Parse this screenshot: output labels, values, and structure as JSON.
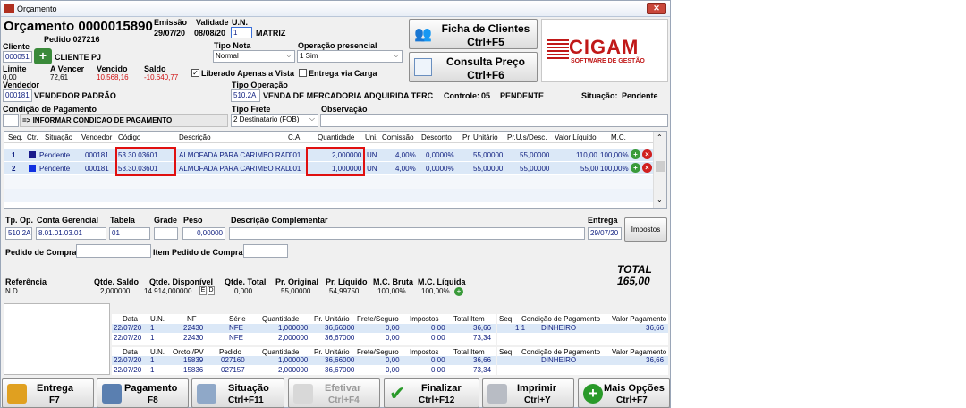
{
  "window": {
    "title": "Orçamento",
    "close": "✕"
  },
  "header": {
    "orcamento_label": "Orçamento 0000015890",
    "pedido": "Pedido 027216",
    "emissao_label": "Emissão",
    "emissao": "29/07/20",
    "validade_label": "Validade",
    "validade": "08/08/20",
    "un_label": "U.N.",
    "un_value": "1",
    "un_name": "MATRIZ"
  },
  "cliente": {
    "label": "Cliente",
    "code": "000051",
    "name": "CLIENTE PJ",
    "limite_label": "Limite",
    "limite": "0,00",
    "avencer_label": "A Vencer",
    "avencer": "72,61",
    "vencido_label": "Vencido",
    "vencido": "10.568,16",
    "saldo_label": "Saldo",
    "saldo": "-10.640,77"
  },
  "tipo_nota": {
    "label": "Tipo Nota",
    "value": "Normal"
  },
  "operacao_presencial": {
    "label": "Operação presencial",
    "value": "1 Sim"
  },
  "liberado": {
    "label": "Liberado Apenas a Vista",
    "checked": true
  },
  "entrega_carga": {
    "label": "Entrega via Carga",
    "checked": false
  },
  "buttons_top": {
    "ficha_l1": "Ficha de Clientes",
    "ficha_l2": "Ctrl+F5",
    "consulta_l1": "Consulta Preço",
    "consulta_l2": "Ctrl+F6"
  },
  "logo": {
    "brand": "CIGAM",
    "tagline": "SOFTWARE DE GESTÃO"
  },
  "vendedor": {
    "label": "Vendedor",
    "code": "000181",
    "name": "VENDEDOR PADRÃO"
  },
  "tipo_operacao": {
    "label": "Tipo Operação",
    "code": "510.2A",
    "name": "VENDA DE MERCADORIA ADQUIRIDA TERC"
  },
  "controle": {
    "label": "Controle:",
    "value": "05",
    "status": "PENDENTE"
  },
  "situacao": {
    "label": "Situação:",
    "value": "Pendente"
  },
  "condicao": {
    "label": "Condição de Pagamento",
    "value": "=> INFORMAR CONDICAO DE PAGAMENTO"
  },
  "tipo_frete": {
    "label": "Tipo Frete",
    "value": "2 Destinatario (FOB)"
  },
  "observacao": {
    "label": "Observação",
    "value": ""
  },
  "grid": {
    "headers": [
      "Seq.",
      "Ctr.",
      "Situação",
      "Vendedor",
      "Código",
      "Descrição",
      "C.A.",
      "Quantidade",
      "Uni.",
      "Comissão",
      "Desconto",
      "Pr. Unitário",
      "Pr.U.s/Desc.",
      "Valor Líquido",
      "M.C."
    ],
    "rows": [
      {
        "seq": "1",
        "situacao": "Pendente",
        "vendedor": "000181",
        "codigo": "53.30.03601",
        "descricao": "ALMOFADA PARA CARIMBO RAD",
        "ca": "001",
        "quantidade": "2,000000",
        "uni": "UN",
        "comissao": "4,00%",
        "desconto": "0,0000%",
        "pr_unitario": "55,00000",
        "pr_us_desc": "55,00000",
        "valor_liquido": "110,00",
        "mc": "100,00%",
        "ctr_color": "#1a1a8a"
      },
      {
        "seq": "2",
        "situacao": "Pendente",
        "vendedor": "000181",
        "codigo": "53.30.03601",
        "descricao": "ALMOFADA PARA CARIMBO RAD",
        "ca": "001",
        "quantidade": "1,000000",
        "uni": "UN",
        "comissao": "4,00%",
        "desconto": "0,0000%",
        "pr_unitario": "55,00000",
        "pr_us_desc": "55,00000",
        "valor_liquido": "55,00",
        "mc": "100,00%",
        "ctr_color": "#1030e0"
      }
    ]
  },
  "detail": {
    "tp_op_label": "Tp. Op.",
    "tp_op": "510.2A",
    "conta_label": "Conta Gerencial",
    "conta": "8.01.01.03.01",
    "tabela_label": "Tabela",
    "tabela": "01",
    "grade_label": "Grade",
    "grade": "",
    "peso_label": "Peso",
    "peso": "0,00000",
    "desc_comp_label": "Descrição Complementar",
    "desc_comp": "",
    "entrega_label": "Entrega",
    "entrega": "29/07/20",
    "impostos": "Impostos",
    "pedido_compra_label": "Pedido de Compra",
    "pedido_compra": "",
    "item_pedido_label": "Item Pedido de Compra",
    "item_pedido": ""
  },
  "total": {
    "label": "TOTAL",
    "value": "165,00"
  },
  "summary": {
    "referencia_label": "Referência",
    "referencia": "N.D.",
    "qtde_saldo_label": "Qtde. Saldo",
    "qtde_saldo": "2,000000",
    "qtde_disp_label": "Qtde. Disponível",
    "qtde_disp": "14.914,000000",
    "e_flag": "E",
    "d_flag": "D",
    "qtde_total_label": "Qtde. Total",
    "qtde_total": "0,000",
    "pr_original_label": "Pr. Original",
    "pr_original": "55,00000",
    "pr_liquido_label": "Pr. Líquido",
    "pr_liquido": "54,99750",
    "mc_bruta_label": "M.C. Bruta",
    "mc_bruta": "100,00%",
    "mc_liquida_label": "M.C. Líquida",
    "mc_liquida": "100,00%"
  },
  "history1": {
    "headers": [
      "Data",
      "U.N.",
      "NF",
      "Série",
      "Quantidade",
      "Pr. Unitário",
      "Frete/Seguro",
      "Impostos",
      "Total Item"
    ],
    "rows": [
      [
        "22/07/20",
        "1",
        "22430",
        "NFE",
        "1,000000",
        "36,66000",
        "0,00",
        "0,00",
        "36,66"
      ],
      [
        "22/07/20",
        "1",
        "22430",
        "NFE",
        "2,000000",
        "36,67000",
        "0,00",
        "0,00",
        "73,34"
      ]
    ],
    "pay_headers": [
      "Seq.",
      "Condição de Pagamento",
      "Valor Pagamento"
    ],
    "pay_rows": [
      [
        "1 1",
        "DINHEIRO",
        "36,66"
      ]
    ]
  },
  "history2": {
    "headers": [
      "Data",
      "U.N.",
      "Orcto./PV",
      "Pedido",
      "Quantidade",
      "Pr. Unitário",
      "Frete/Seguro",
      "Impostos",
      "Total Item"
    ],
    "rows": [
      [
        "22/07/20",
        "1",
        "15839",
        "027160",
        "1,000000",
        "36,66000",
        "0,00",
        "0,00",
        "36,66"
      ],
      [
        "22/07/20",
        "1",
        "15836",
        "027157",
        "2,000000",
        "36,67000",
        "0,00",
        "0,00",
        "73,34"
      ]
    ],
    "pay_headers": [
      "Seq.",
      "Condição de Pagamento",
      "Valor Pagamento"
    ],
    "pay_rows": [
      [
        "",
        "DINHEIRO",
        "36,66"
      ]
    ]
  },
  "bottom_buttons": [
    {
      "l1": "Entrega",
      "l2": "F7"
    },
    {
      "l1": "Pagamento",
      "l2": "F8"
    },
    {
      "l1": "Situação",
      "l2": "Ctrl+F11"
    },
    {
      "l1": "Efetivar",
      "l2": "Ctrl+F4"
    },
    {
      "l1": "Finalizar",
      "l2": "Ctrl+F12"
    },
    {
      "l1": "Imprimir",
      "l2": "Ctrl+Y"
    },
    {
      "l1": "Mais Opções",
      "l2": "Ctrl+F7"
    }
  ]
}
